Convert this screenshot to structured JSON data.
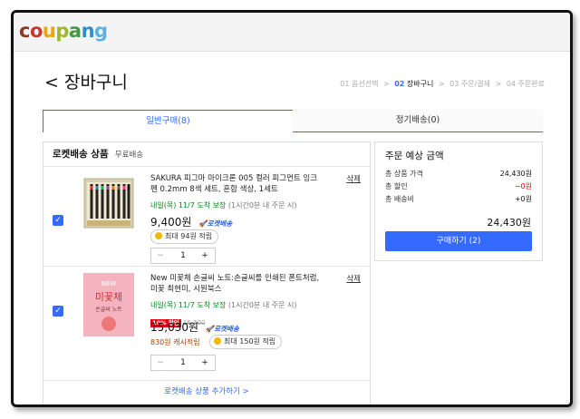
{
  "logo": {
    "letters": [
      "c",
      "o",
      "u",
      "p",
      "a",
      "n",
      "g"
    ],
    "colors": [
      "#8a3a20",
      "#c8382a",
      "#f2a100",
      "#9db82d",
      "#3f9a44",
      "#2e8ec9",
      "#58b1e3"
    ]
  },
  "page_title": "< 장바구니",
  "steps": {
    "s1": "01 옵션선택",
    "s2_num": "02",
    "s2_label": "장바구니",
    "s3": "03 주문/결제",
    "s4": "04 주문완료",
    "sep": ">"
  },
  "tabs": {
    "general": "일반구매(8)",
    "subscription": "정기배송(0)"
  },
  "cart": {
    "section_title": "로켓배송 상품",
    "section_sub": "무료배송",
    "items": [
      {
        "name": "SAKURA 피그마 마이크론 005 컬러 피그먼트 잉크펜 0.2mm 8색 세트, 혼합 색상, 1세트",
        "delete": "삭제",
        "shipping": "내일(목) 11/7 도착 보장",
        "shipping_note": "(1시간0분 내 주문 시)",
        "price": "9,400원",
        "rocket": "🚀로켓배송",
        "reward": "최대 94원 적립",
        "qty": "1",
        "minus": "−",
        "plus": "+"
      },
      {
        "name": "New 미꽃체 손글씨 노트:손글씨를 인쇄된 폰트처럼, 미꽃 최현미, 시원북스",
        "delete": "삭제",
        "shipping": "내일(목) 11/7 도착 보장",
        "shipping_note": "(1시간0분 내 주문 시)",
        "discount": "10% 할인",
        "original_price": "16,700",
        "price": "15,030원",
        "rocket": "🚀로켓배송",
        "cash": "830원 캐시적립",
        "reward": "최대 150원 적립",
        "qty": "1",
        "minus": "−",
        "plus": "+",
        "cover_top": "NEW",
        "cover_title": "미꽃체",
        "cover_sub": "손글씨 노트"
      }
    ],
    "add_more": "로켓배송 상품 추가하기 >"
  },
  "summary": {
    "title": "주문 예상 금액",
    "rows": [
      {
        "label": "총 상품 가격",
        "value": "24,430원"
      },
      {
        "label": "총 할인",
        "value": "−0원"
      },
      {
        "label": "총 배송비",
        "value": "+0원"
      }
    ],
    "total": "24,430원",
    "buy_button": "구매하기 (2)"
  }
}
